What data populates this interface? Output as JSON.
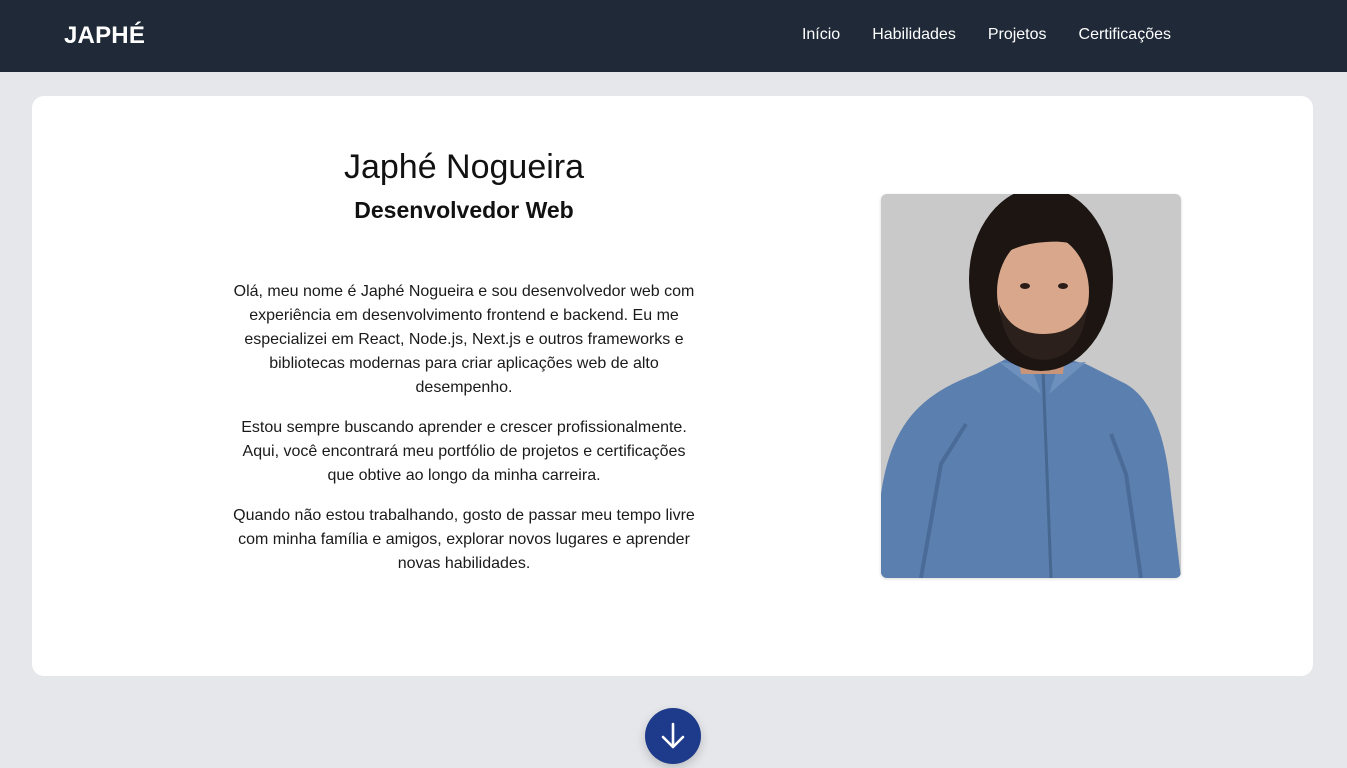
{
  "header": {
    "brand": "JAPHÉ",
    "nav": [
      {
        "label": "Início"
      },
      {
        "label": "Habilidades"
      },
      {
        "label": "Projetos"
      },
      {
        "label": "Certificações"
      }
    ]
  },
  "profile": {
    "name": "Japhé Nogueira",
    "role": "Desenvolvedor Web",
    "bio": [
      "Olá, meu nome é Japhé Nogueira e sou desenvolvedor web com experiência em desenvolvimento frontend e backend. Eu me especializei em React, Node.js, Next.js e outros frameworks e bibliotecas modernas para criar aplicações web de alto desempenho.",
      "Estou sempre buscando aprender e crescer profissionalmente. Aqui, você encontrará meu portfólio de projetos e certificações que obtive ao longo da minha carreira.",
      "Quando não estou trabalhando, gosto de passar meu tempo livre com minha família e amigos, explorar novos lugares e aprender novas habilidades."
    ],
    "photo_icon": "profile-photo"
  },
  "scroll_button": {
    "icon": "arrow-down-icon"
  },
  "colors": {
    "navbar": "#1f2937",
    "page_background": "#e5e7eb",
    "card": "#ffffff",
    "accent": "#1e3a8a"
  }
}
